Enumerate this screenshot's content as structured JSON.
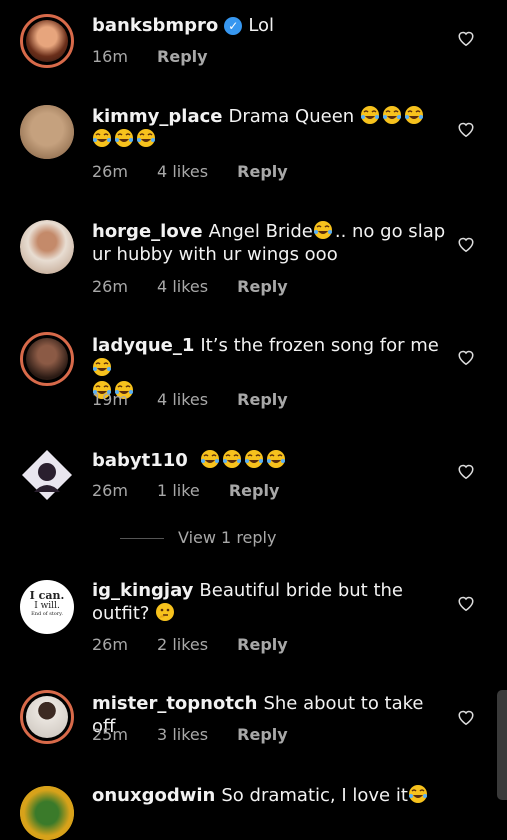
{
  "comments": [
    {
      "username": "banksbmpro",
      "verified": true,
      "text": "Lol",
      "emojis": 0,
      "time": "16m",
      "likes": "",
      "reply": "Reply",
      "avatar_color": "#8a4b2f"
    },
    {
      "username": "kimmy_place",
      "verified": false,
      "text": "Drama Queen",
      "emojis": 6,
      "time": "26m",
      "likes": "4 likes",
      "reply": "Reply",
      "avatar_color": "#a68266"
    },
    {
      "username": "horge_love",
      "verified": false,
      "text": "Angel Bride",
      "text2": ".. no go slap ur hubby with ur wings ooo",
      "emojis": 1,
      "time": "26m",
      "likes": "4 likes",
      "reply": "Reply",
      "avatar_color": "#d9c8b6"
    },
    {
      "username": "ladyque_1",
      "verified": false,
      "text": "It’s the frozen song for me",
      "emojis": 3,
      "time": "19m",
      "likes": "4 likes",
      "reply": "Reply",
      "avatar_color": "#4a3028"
    },
    {
      "username": "babyt110",
      "verified": false,
      "text": "",
      "emojis": 4,
      "time": "26m",
      "likes": "1 like",
      "reply": "Reply",
      "avatar_color": "#6b5a88"
    },
    {
      "username": "ig_kingjay",
      "verified": false,
      "text": "Beautiful bride but the outfit?",
      "emojis": 0,
      "time": "26m",
      "likes": "2 likes",
      "reply": "Reply",
      "avatar_color": "#ffffff"
    },
    {
      "username": "mister_topnotch",
      "verified": false,
      "text": "She about to take off",
      "emojis": 0,
      "time": "25m",
      "likes": "3 likes",
      "reply": "Reply",
      "avatar_color": "#3b3a38"
    },
    {
      "username": "onuxgodwin",
      "verified": false,
      "text": "So dramatic, I love it",
      "emojis": 1,
      "time": "",
      "likes": "",
      "reply": "",
      "avatar_color": "#d8a21a"
    }
  ],
  "view_replies": "View 1 reply",
  "kingjay_avatar": {
    "line1": "I can.",
    "line2": "I will.",
    "line3": "End of story."
  },
  "colors": {
    "emoji": "#f7c21d",
    "ring": "#d86a4a",
    "muted": "#a8a8a8"
  },
  "icons": {
    "heart": "heart-outline-icon",
    "verified": "verified-badge-icon",
    "laugh": "tears-of-joy-emoji-icon",
    "thinking": "thinking-face-emoji-icon"
  }
}
